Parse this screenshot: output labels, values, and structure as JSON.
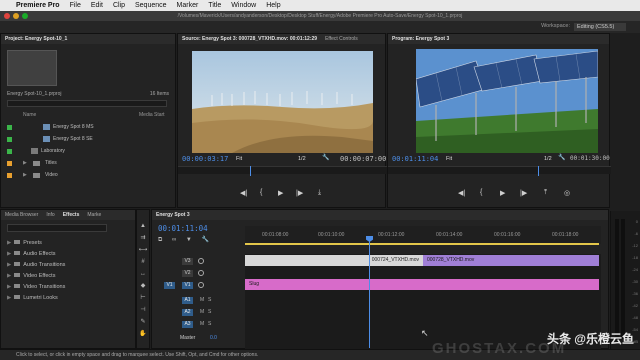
{
  "menubar": {
    "app": "Premiere Pro",
    "items": [
      "File",
      "Edit",
      "Clip",
      "Sequence",
      "Marker",
      "Title",
      "Window",
      "Help"
    ]
  },
  "titlebar": {
    "path": "/Volumes/Maverick/Users/andyanderson/Desktop/Desktop Stuff/Energy/Adobe Premiere Pro Auto-Save/Energy Spot-10_1.prproj"
  },
  "workspace": {
    "label": "Workspace:",
    "value": "Editing (CS5.5)"
  },
  "project": {
    "tab": "Project: Energy Spot-10_1",
    "file": "Energy Spot-10_1.prproj",
    "items": "16 Items",
    "col_name": "Name",
    "col_media_start": "Media Start",
    "rows": [
      {
        "label": "Energy Spot 8 MS",
        "color": "#3bb54a",
        "kind": "sequence"
      },
      {
        "label": "Energy Spot 8 SE",
        "color": "#3bb54a",
        "kind": "sequence"
      },
      {
        "label": "Laboratory",
        "color": "#3bb54a",
        "kind": "bin"
      },
      {
        "label": "Titles",
        "color": "#e8a02f",
        "kind": "folder"
      },
      {
        "label": "Video",
        "color": "#e8a02f",
        "kind": "folder"
      }
    ]
  },
  "source": {
    "tab": "Source: Energy Spot 3: 000728_VTXHD.mov: 00:01:12:29",
    "tab2": "Effect Controls",
    "timecode": "00:00:03:17",
    "fit": "Fit",
    "ratio": "1/2",
    "duration": "00:00:07:00"
  },
  "program": {
    "tab": "Program: Energy Spot 3",
    "timecode": "00:01:11:04",
    "fit": "Fit",
    "ratio": "1/2",
    "duration": "00:01:30:00"
  },
  "effects": {
    "tabs": [
      "Media Browser",
      "Info",
      "Effects",
      "Marke"
    ],
    "items": [
      "Presets",
      "Audio Effects",
      "Audio Transitions",
      "Video Effects",
      "Video Transitions",
      "Lumetri Looks"
    ]
  },
  "timeline": {
    "tab": "Energy Spot 3",
    "timecode": "00:01:11:04",
    "ruler": [
      "00:01:08:00",
      "00:01:10:00",
      "00:01:12:00",
      "00:01:14:00",
      "00:01:16:00",
      "00:01:18:00"
    ],
    "tracks": {
      "v3": "V3",
      "v2": "V2",
      "v1": "V1",
      "v1src": "V1",
      "a1": "A1",
      "a2": "A2",
      "a3": "A3",
      "master": "Master",
      "master_val": "0.0"
    },
    "clips": {
      "clip_a": "000724_VTXHD.mov",
      "clip_b": "000728_VTXHD.mov",
      "slug": "Slug"
    }
  },
  "meter": {
    "ticks": [
      "0",
      "-6",
      "-12",
      "-18",
      "-24",
      "-30",
      "-36",
      "-42",
      "-48",
      "-54",
      "dB"
    ]
  },
  "status": {
    "text": "Click to select, or click in empty space and drag to marquee select. Use Shift, Opt, and Cmd for other options."
  },
  "watermark": {
    "text": "头条 @乐橙云鱼",
    "ghost": "GHOSTAX.COM"
  },
  "colors": {
    "accent_blue": "#4d8ee8",
    "clip_grey": "#d8d8d8",
    "clip_purple": "#a07fd6",
    "clip_pink": "#d76bc9"
  }
}
